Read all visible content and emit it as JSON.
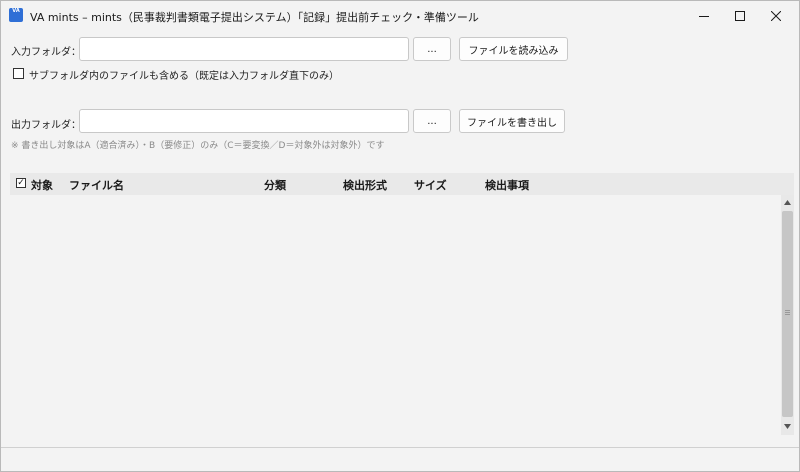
{
  "window": {
    "app_icon_text": "VA",
    "title": "VA mints – mints（民事裁判書類電子提出システム）「記録」提出前チェック・準備ツール"
  },
  "input": {
    "label": "入力フォルダ：",
    "value": "",
    "browse_label": "...",
    "load_label": "ファイルを読み込み",
    "subfolder_label": "サブフォルダ内のファイルも含める（既定は入力フォルダ直下のみ）",
    "subfolder_checked": false
  },
  "output": {
    "label": "出力フォルダ：",
    "value": "",
    "browse_label": "...",
    "export_label": "ファイルを書き出し",
    "note": "※ 書き出し対象はA（適合済み）・B（要修正）のみ（C＝要変換／D＝対象外は対象外）です"
  },
  "table": {
    "select_all_checked": true,
    "columns": {
      "target": "対象",
      "filename": "ファイル名",
      "category": "分類",
      "detected_format": "検出形式",
      "size": "サイズ",
      "findings": "検出事項"
    },
    "rows": []
  },
  "status": {
    "text": ""
  }
}
